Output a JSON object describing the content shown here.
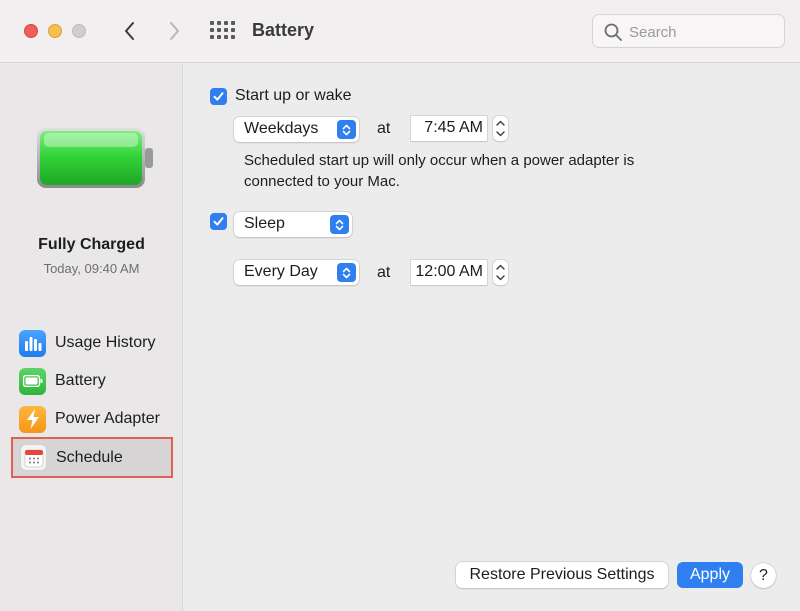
{
  "window": {
    "title": "Battery",
    "search_placeholder": "Search"
  },
  "sidebar": {
    "status_title": "Fully Charged",
    "status_time": "Today, 09:40 AM",
    "items": [
      {
        "label": "Usage History",
        "icon": "usage-history-icon"
      },
      {
        "label": "Battery",
        "icon": "battery-icon"
      },
      {
        "label": "Power Adapter",
        "icon": "power-adapter-icon"
      },
      {
        "label": "Schedule",
        "icon": "schedule-icon",
        "selected": true
      }
    ]
  },
  "schedule": {
    "startup": {
      "checked": true,
      "label": "Start up or wake",
      "repeat": "Weekdays",
      "at_label": "at",
      "time": "7:45 AM",
      "note": "Scheduled start up will only occur when a power adapter is connected to your Mac."
    },
    "sleep": {
      "checked": true,
      "action": "Sleep",
      "repeat": "Every Day",
      "at_label": "at",
      "time": "12:00 AM"
    }
  },
  "footer": {
    "restore_label": "Restore Previous Settings",
    "apply_label": "Apply",
    "help_label": "?"
  },
  "colors": {
    "accent": "#2f7ff0",
    "selection_outline": "#e25f56",
    "battery_fill": "#3fd24a"
  }
}
